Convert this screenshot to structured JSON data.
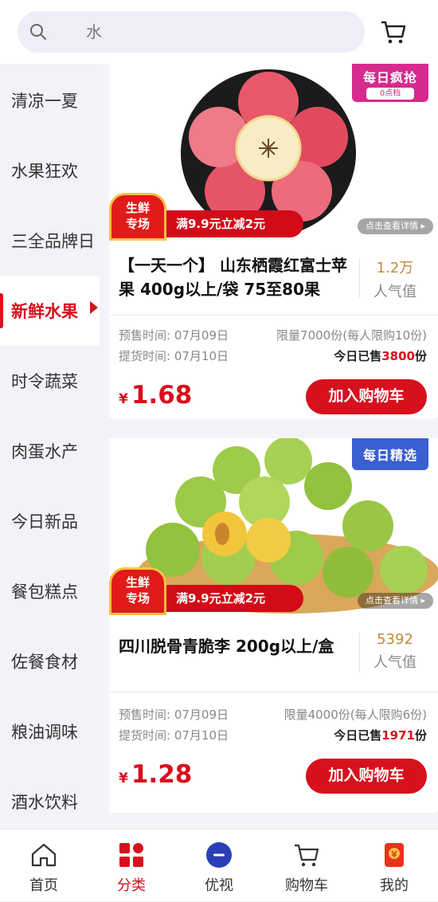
{
  "search": {
    "text": "水",
    "icon": "search-icon"
  },
  "header": {
    "cart_icon": "cart-icon"
  },
  "sidebar": {
    "items": [
      {
        "label": "清凉一夏"
      },
      {
        "label": "水果狂欢"
      },
      {
        "label": "三全品牌日"
      },
      {
        "label": "新鲜水果",
        "active": true
      },
      {
        "label": "时令蔬菜"
      },
      {
        "label": "肉蛋水产"
      },
      {
        "label": "今日新品"
      },
      {
        "label": "餐包糕点"
      },
      {
        "label": "佐餐食材"
      },
      {
        "label": "粮油调味"
      },
      {
        "label": "酒水饮料"
      }
    ]
  },
  "products": [
    {
      "badge_main": "每日疯抢",
      "badge_sub": "0点档",
      "promo_tag_line1": "生鲜",
      "promo_tag_line2": "专场",
      "promo_text": "满9.9元立减2元",
      "detail_chip": "点击查看详情 ▸",
      "title": "【一天一个】 山东栖霞红富士苹果 400g以上/袋  75至80果",
      "popularity": "1.2万",
      "popularity_label": "人气值",
      "presale_time": "预售时间: 07月09日",
      "pickup_time": "提货时间: 07月10日",
      "limit": "限量7000份(每人限购10份)",
      "sold_prefix": "今日已售",
      "sold_count": "3800",
      "sold_suffix": "份",
      "currency": "¥",
      "price": "1.68",
      "add_label": "加入购物车"
    },
    {
      "badge_main": "每日精选",
      "promo_tag_line1": "生鲜",
      "promo_tag_line2": "专场",
      "promo_text": "满9.9元立减2元",
      "detail_chip": "点击查看详情 ▸",
      "title": "四川脱骨青脆李 200g以上/盒",
      "popularity": "5392",
      "popularity_label": "人气值",
      "presale_time": "预售时间: 07月09日",
      "pickup_time": "提货时间: 07月10日",
      "limit": "限量4000份(每人限购6份)",
      "sold_prefix": "今日已售",
      "sold_count": "1971",
      "sold_suffix": "份",
      "currency": "¥",
      "price": "1.28",
      "add_label": "加入购物车"
    }
  ],
  "tabbar": {
    "items": [
      {
        "label": "首页",
        "icon": "home-icon"
      },
      {
        "label": "分类",
        "icon": "category-icon",
        "active": true
      },
      {
        "label": "优视",
        "icon": "video-icon"
      },
      {
        "label": "购物车",
        "icon": "cart-icon"
      },
      {
        "label": "我的",
        "icon": "profile-icon"
      }
    ]
  },
  "colors": {
    "accent": "#d7101e",
    "popularity": "#c28a3a",
    "badge_pink": "#d52a8e",
    "badge_blue": "#3a5fd1"
  }
}
